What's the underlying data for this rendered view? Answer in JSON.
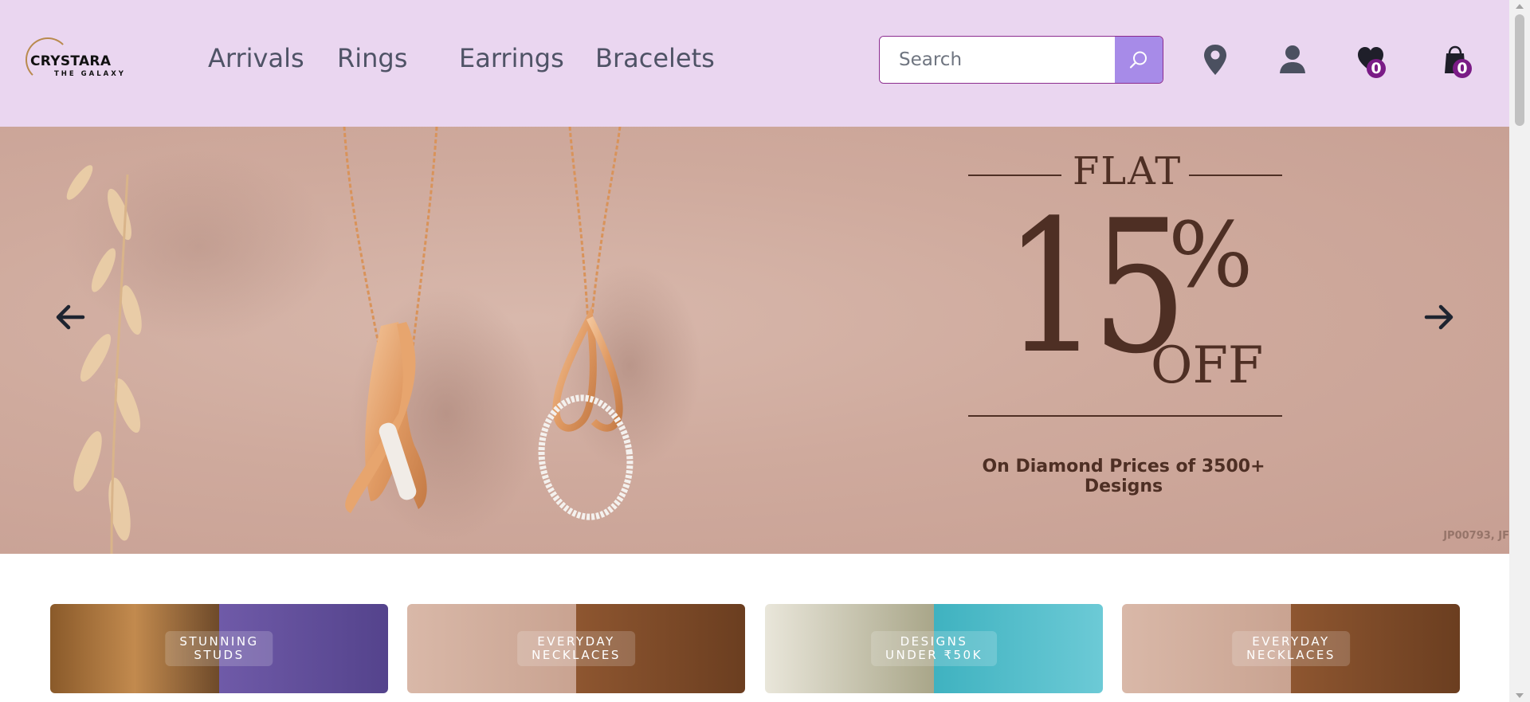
{
  "brand": {
    "name": "CRYSTARA",
    "tagline": "THE GALAXY"
  },
  "nav": {
    "items": [
      "Arrivals",
      "Rings",
      "Earrings",
      "Bracelets"
    ]
  },
  "search": {
    "placeholder": "Search",
    "icon": "search-icon"
  },
  "header_icons": {
    "location": "location-pin-icon",
    "account": "user-icon",
    "wishlist": {
      "icon": "heart-icon",
      "count": "0"
    },
    "cart": {
      "icon": "shopping-bag-icon",
      "count": "0"
    }
  },
  "hero": {
    "promo": {
      "flat": "FLAT",
      "number": "15",
      "percent": "%",
      "off": "OFF",
      "subline": "On Diamond Prices of 3500+ Designs"
    },
    "code": "JP00793, JF",
    "prev_icon": "arrow-left-icon",
    "next_icon": "arrow-right-icon"
  },
  "tiles": [
    {
      "line1": "STUNNING",
      "line2": "STUDS"
    },
    {
      "line1": "EVERYDAY",
      "line2": "NECKLACES"
    },
    {
      "line1": "DESIGNS",
      "line2": "UNDER ₹50K"
    },
    {
      "line1": "EVERYDAY",
      "line2": "NECKLACES"
    }
  ],
  "colors": {
    "header_bg": "#ead6f0",
    "search_button": "#a78be8",
    "badge": "#7a1b86",
    "promo_text": "#4e2f24"
  }
}
